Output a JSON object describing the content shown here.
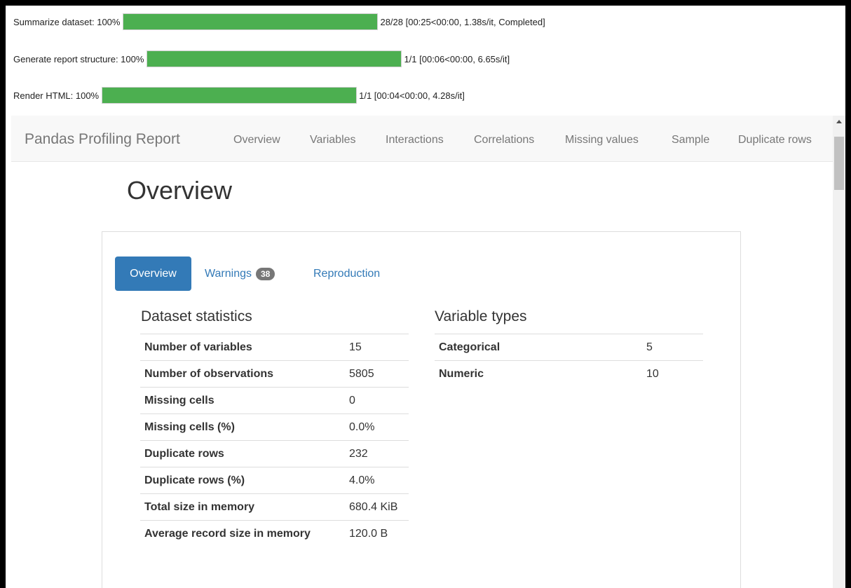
{
  "progress_bars": [
    {
      "label": "Summarize dataset: 100%",
      "fraction": 1.0,
      "info": "28/28 [00:25<00:00, 1.38s/it, Completed]"
    },
    {
      "label": "Generate report structure: 100%",
      "fraction": 1.0,
      "info": "1/1 [00:06<00:00, 6.65s/it]"
    },
    {
      "label": "Render HTML: 100%",
      "fraction": 1.0,
      "info": "1/1 [00:04<00:00, 4.28s/it]"
    }
  ],
  "navbar": {
    "brand": "Pandas Profiling Report",
    "items": [
      "Overview",
      "Variables",
      "Interactions",
      "Correlations",
      "Missing values",
      "Sample",
      "Duplicate rows"
    ]
  },
  "page": {
    "title": "Overview"
  },
  "tabs": {
    "overview": "Overview",
    "warnings": "Warnings",
    "warnings_count": "38",
    "reproduction": "Reproduction"
  },
  "dataset_statistics": {
    "title": "Dataset statistics",
    "rows": [
      {
        "key": "Number of variables",
        "value": "15"
      },
      {
        "key": "Number of observations",
        "value": "5805"
      },
      {
        "key": "Missing cells",
        "value": "0"
      },
      {
        "key": "Missing cells (%)",
        "value": "0.0%"
      },
      {
        "key": "Duplicate rows",
        "value": "232"
      },
      {
        "key": "Duplicate rows (%)",
        "value": "4.0%"
      },
      {
        "key": "Total size in memory",
        "value": "680.4 KiB"
      },
      {
        "key": "Average record size in memory",
        "value": "120.0 B"
      }
    ]
  },
  "variable_types": {
    "title": "Variable types",
    "rows": [
      {
        "key": "Categorical",
        "value": "5"
      },
      {
        "key": "Numeric",
        "value": "10"
      }
    ]
  },
  "colors": {
    "progress_fill": "#4caf50",
    "active_tab": "#337ab7",
    "link": "#337ab7",
    "badge": "#777777"
  }
}
